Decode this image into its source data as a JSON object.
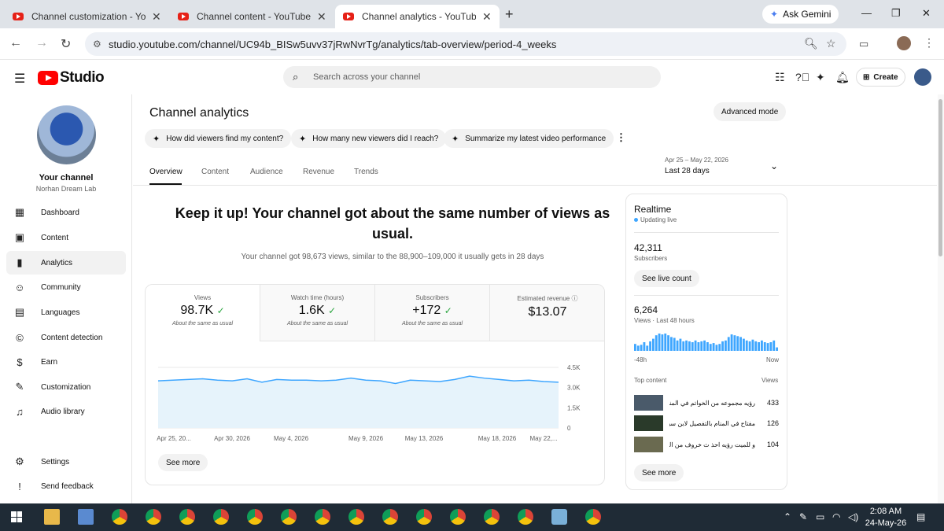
{
  "browser": {
    "tabs": [
      {
        "title": "Channel customization - YouTube Studio",
        "active": false
      },
      {
        "title": "Channel content - YouTube Studio",
        "active": false
      },
      {
        "title": "Channel analytics - YouTube Studio",
        "active": true
      }
    ],
    "ask_gemini": "Ask Gemini",
    "url": "studio.youtube.com/channel/UC94b_BISw5uvv37jRwNvrTg/analytics/tab-overview/period-4_weeks"
  },
  "header": {
    "logo_text": "Studio",
    "search_placeholder": "Search across your channel",
    "create_label": "Create"
  },
  "sidebar": {
    "your_channel": "Your channel",
    "channel_name": "Norhan Dream Lab",
    "items": [
      {
        "label": "Dashboard",
        "icon": "dashboard-icon"
      },
      {
        "label": "Content",
        "icon": "content-icon"
      },
      {
        "label": "Analytics",
        "icon": "analytics-icon",
        "active": true
      },
      {
        "label": "Community",
        "icon": "community-icon"
      },
      {
        "label": "Languages",
        "icon": "languages-icon"
      },
      {
        "label": "Content detection",
        "icon": "copyright-icon"
      },
      {
        "label": "Earn",
        "icon": "earn-icon"
      },
      {
        "label": "Customization",
        "icon": "customization-icon"
      },
      {
        "label": "Audio library",
        "icon": "audio-library-icon"
      }
    ],
    "settings": "Settings",
    "feedback": "Send feedback"
  },
  "page": {
    "title": "Channel analytics",
    "advanced_mode": "Advanced mode",
    "chips": [
      "How did viewers find my content?",
      "How many new viewers did I reach?",
      "Summarize my latest video performance"
    ],
    "tabs": [
      "Overview",
      "Content",
      "Audience",
      "Revenue",
      "Trends"
    ],
    "date_range": "Apr 25 – May 22, 2026",
    "period": "Last 28 days",
    "headline": "Keep it up! Your channel got about the same number of views as usual.",
    "subline": "Your channel got 98,673 views, similar to the 88,900–109,000 it usually gets in 28 days",
    "metrics": [
      {
        "label": "Views",
        "value": "98.7K",
        "note": "About the same as usual"
      },
      {
        "label": "Watch time (hours)",
        "value": "1.6K",
        "note": "About the same as usual"
      },
      {
        "label": "Subscribers",
        "value": "+172",
        "note": "About the same as usual"
      },
      {
        "label": "Estimated revenue",
        "value": "$13.07",
        "note": ""
      }
    ],
    "see_more": "See more"
  },
  "chart_data": {
    "type": "area",
    "x_labels": [
      "Apr 25, 20...",
      "Apr 30, 2026",
      "May 4, 2026",
      "May 9, 2026",
      "May 13, 2026",
      "May 18, 2026",
      "May 22,..."
    ],
    "y_ticks": [
      "4.5K",
      "3.0K",
      "1.5K",
      "0"
    ],
    "ylim": [
      0,
      4500
    ],
    "values": [
      3500,
      3550,
      3600,
      3650,
      3550,
      3500,
      3650,
      3400,
      3600,
      3550,
      3550,
      3500,
      3550,
      3700,
      3550,
      3500,
      3300,
      3550,
      3500,
      3450,
      3600,
      3850,
      3700,
      3600,
      3500,
      3550,
      3450,
      3400
    ],
    "color": "#3ea6ff"
  },
  "realtime": {
    "title": "Realtime",
    "status": "Updating live",
    "subscribers": "42,311",
    "subscribers_label": "Subscribers",
    "see_live": "See live count",
    "views": "6,264",
    "views_label": "Views · Last 48 hours",
    "axis_start": "-48h",
    "axis_end": "Now",
    "hourly_views": [
      40,
      30,
      35,
      50,
      30,
      55,
      70,
      90,
      100,
      95,
      100,
      90,
      80,
      75,
      60,
      70,
      55,
      60,
      55,
      50,
      60,
      50,
      55,
      60,
      50,
      40,
      45,
      35,
      40,
      55,
      60,
      80,
      95,
      90,
      85,
      80,
      70,
      60,
      55,
      65,
      55,
      50,
      60,
      50,
      45,
      50,
      60,
      20
    ],
    "top_content_label": "Top content",
    "views_col": "Views",
    "top_content": [
      {
        "title": "رؤيه مجموعه من الخواتم في المنام",
        "views": "433"
      },
      {
        "title": "مفتاح في المنام بالتفصيل لابن سيرين...",
        "views": "126"
      },
      {
        "title": "و للميت رؤيه احذ ث خروف من الميت...",
        "views": "104"
      }
    ],
    "see_more": "See more"
  },
  "taskbar": {
    "time": "2:08 AM",
    "date": "24-May-26"
  }
}
